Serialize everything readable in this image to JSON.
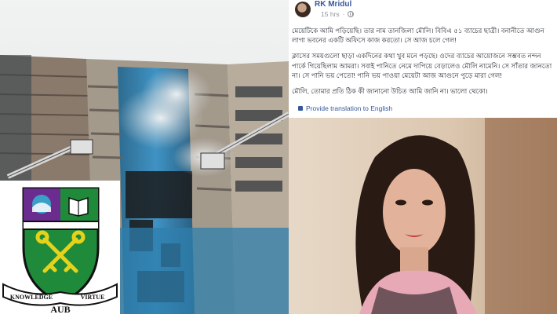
{
  "post": {
    "author": "RK Mridul",
    "time": "15 hrs",
    "paragraphs": [
      "মেয়েটিকে আমি পড়িয়েছি। তার নাম তানজিলা মৌলি। বিবিএ ৫১ ব্যাচের ছাত্রী। বনানীতে আগুন লাগা ভবনের একটি অফিসে কাজ করতো। সে আজ চলে গেল!",
      "ক্লাসের সময়গুলো ছাড়া একদিনের কথা খুব মনে পড়ছে। ওদের ব্যাচের আয়োজনে সম্ভবত নন্দন পার্কে গিয়েছিলাম আমরা। সবাই পানিতে নেমে দাপিয়ে বেড়ালেও মৌলি নামেনি। সে সাঁতার জানতো না। সে পানি ভয় পেতো! পানি ভয় পাওয়া মেয়েটা আজ আগুনে পুড়ে মারা গেল!",
      "মৌলি, তোমার প্রতি ঠিক কী জানানো উচিত আমি জানি না। ভালো থেকো।"
    ],
    "translate_link": "Provide translation to English"
  },
  "logo": {
    "banner_left": "KNOWLEDGE",
    "banner_right": "VIRTUE",
    "abbr": "AUB"
  },
  "colors": {
    "link": "#365899",
    "shield_purple": "#6a2c8e",
    "shield_green": "#1f8a3a",
    "keys_gold": "#e7d21a",
    "fire_sky": "#e9ecec"
  }
}
